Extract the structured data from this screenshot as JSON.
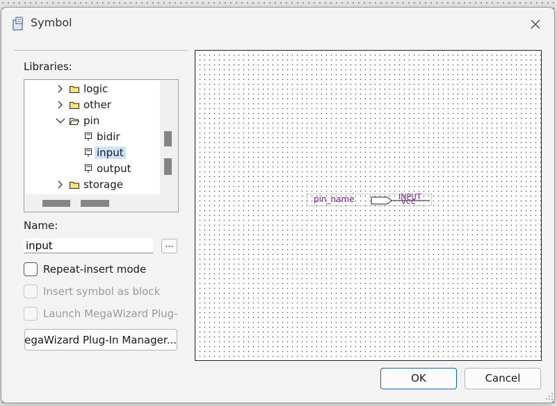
{
  "window": {
    "title": "Symbol",
    "icon": "symbol-app-icon"
  },
  "libraries": {
    "label": "Libraries:",
    "items": [
      {
        "label": "logic",
        "expanded": false,
        "type": "folder"
      },
      {
        "label": "other",
        "expanded": false,
        "type": "folder"
      },
      {
        "label": "pin",
        "expanded": true,
        "type": "folder-open"
      },
      {
        "label": "bidir",
        "type": "pin"
      },
      {
        "label": "input",
        "type": "pin",
        "selected": true
      },
      {
        "label": "output",
        "type": "pin"
      },
      {
        "label": "storage",
        "expanded": false,
        "type": "folder"
      }
    ]
  },
  "name": {
    "label": "Name:",
    "value": "input",
    "browse_label": "..."
  },
  "options": {
    "repeat_insert": {
      "label": "Repeat-insert mode",
      "checked": false,
      "enabled": true
    },
    "insert_block": {
      "label": "Insert symbol as block",
      "checked": false,
      "enabled": false
    },
    "launch_megawizard": {
      "label": "Launch MegaWizard Plug-In",
      "checked": false,
      "enabled": false
    }
  },
  "megawizard_button": "MegaWizard Plug-In Manager...",
  "preview": {
    "pin_name": "pin_name",
    "pin_type": "INPUT",
    "pin_default": "VCC"
  },
  "buttons": {
    "ok": "OK",
    "cancel": "Cancel"
  }
}
